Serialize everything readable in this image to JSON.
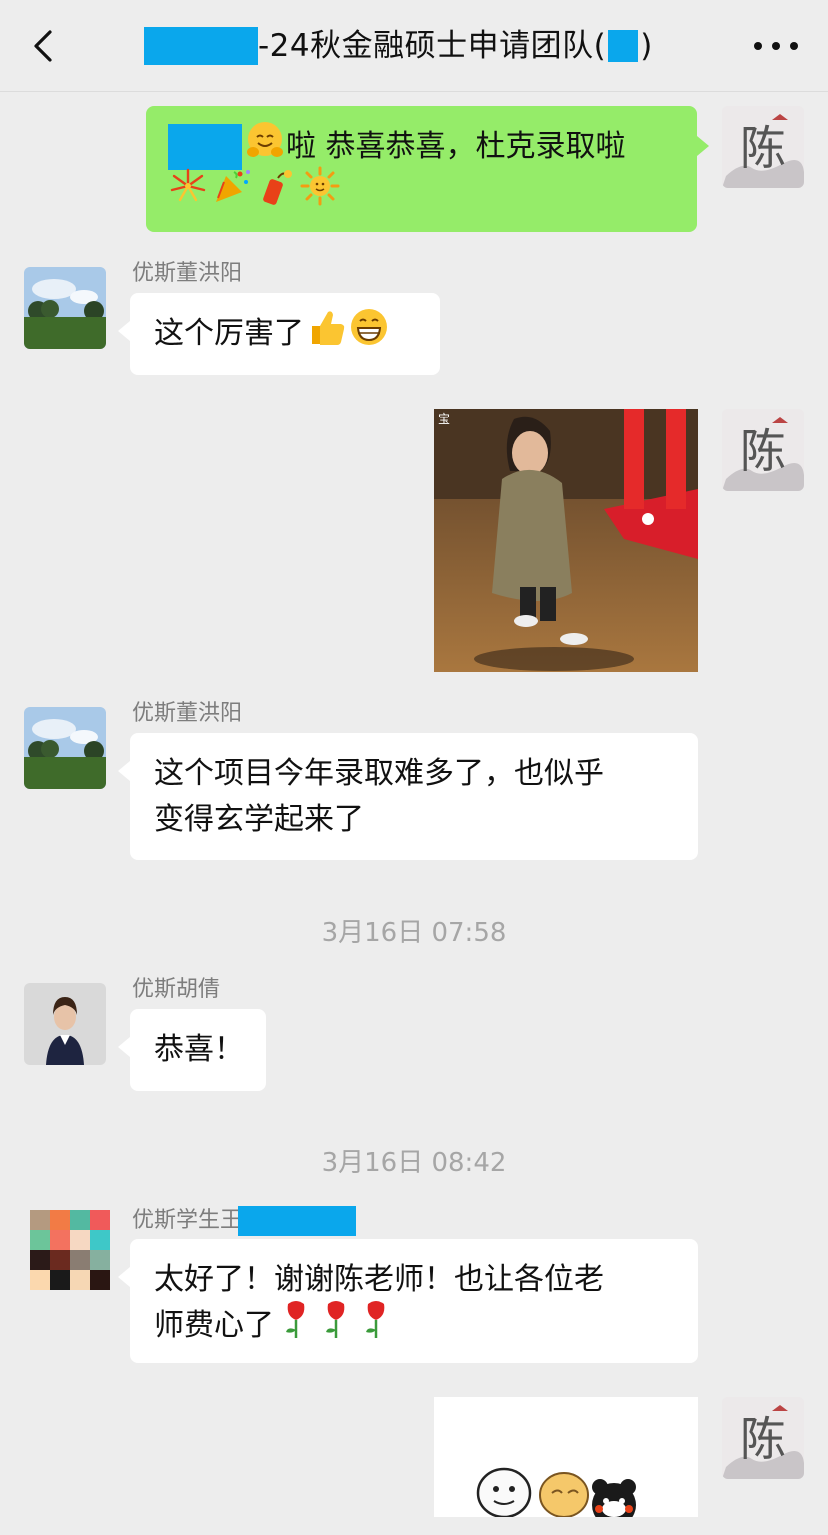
{
  "header": {
    "title": "-24秋金融硕士申请团队(",
    "title_close": ")"
  },
  "messages": {
    "m1": {
      "prefix": "",
      "text1": "啦 恭喜恭喜，杜克录取啦"
    },
    "m2": {
      "sender": "优斯董洪阳",
      "text": "这个厉害了"
    },
    "m3": {
      "image_tag": "宝"
    },
    "m4": {
      "sender": "优斯董洪阳",
      "line1": "这个项目今年录取难多了，也似乎",
      "line2": "变得玄学起来了"
    },
    "ts1": "3月16日 07:58",
    "m5": {
      "sender": "优斯胡倩",
      "text": "恭喜！"
    },
    "ts2": "3月16日 08:42",
    "m6": {
      "sender": "优斯学生王",
      "line1": "太好了！谢谢陈老师！也让各位老",
      "line2": "师费心了"
    }
  },
  "avatars": {
    "self": {
      "glyph": "陈"
    }
  },
  "colors": {
    "background": "#ededed",
    "self_bubble": "#95ec69",
    "other_bubble": "#ffffff",
    "redaction": "#0aa7ec",
    "sender_name": "#7d7d7d",
    "timestamp": "#a6a6a6"
  }
}
